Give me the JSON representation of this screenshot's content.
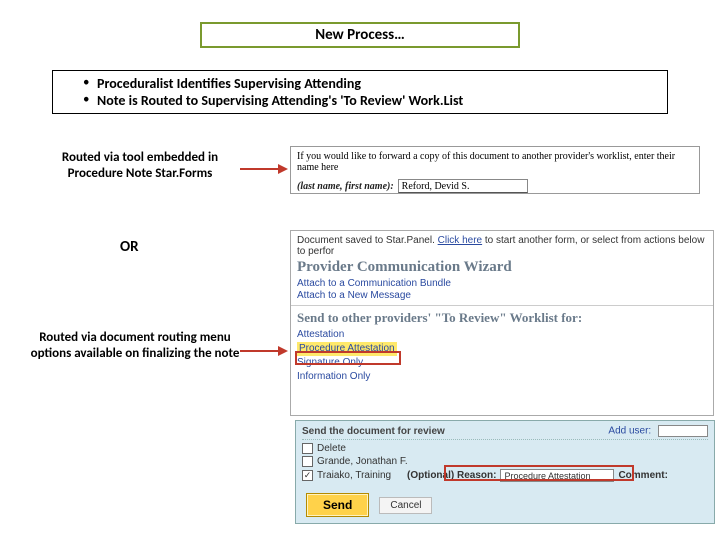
{
  "title": "New Process…",
  "bullets": [
    "Proceduralist Identifies Supervising Attending",
    "Note is Routed to Supervising Attending's 'To Review' Work.List"
  ],
  "caption1": "Routed via tool embedded in Procedure Note Star.Forms",
  "or": "OR",
  "caption2": "Routed via document routing menu options available on finalizing the note",
  "panel1": {
    "instruct": "If you would like to forward a copy of this document to another provider's worklist, enter their name here",
    "label": "(last name, first name):",
    "value": "Reford, Devid S."
  },
  "panel2": {
    "saved_prefix": "Document saved to Star.Panel. ",
    "click_here": "Click here",
    "saved_suffix": " to start another form, or select from actions below to perfor",
    "wizard_title": "Provider Communication Wizard",
    "link1": "Attach to a Communication Bundle",
    "link2": "Attach to a New Message",
    "send_header": "Send to other providers' \"To Review\" Worklist for:",
    "options": [
      "Attestation",
      "Procedure Attestation",
      "Signature Only",
      "Information Only"
    ]
  },
  "panel3": {
    "header": "Send the document for review",
    "adduser_label": "Add user:",
    "rows": [
      {
        "checked": false,
        "name": "Delete"
      },
      {
        "checked": false,
        "name": "Grande, Jonathan F."
      },
      {
        "checked": true,
        "name": "Traiako, Training"
      }
    ],
    "optional_label": "(Optional) Reason:",
    "reason_value": "Procedure Attestation",
    "comment_label": "Comment:",
    "send": "Send",
    "cancel": "Cancel"
  }
}
